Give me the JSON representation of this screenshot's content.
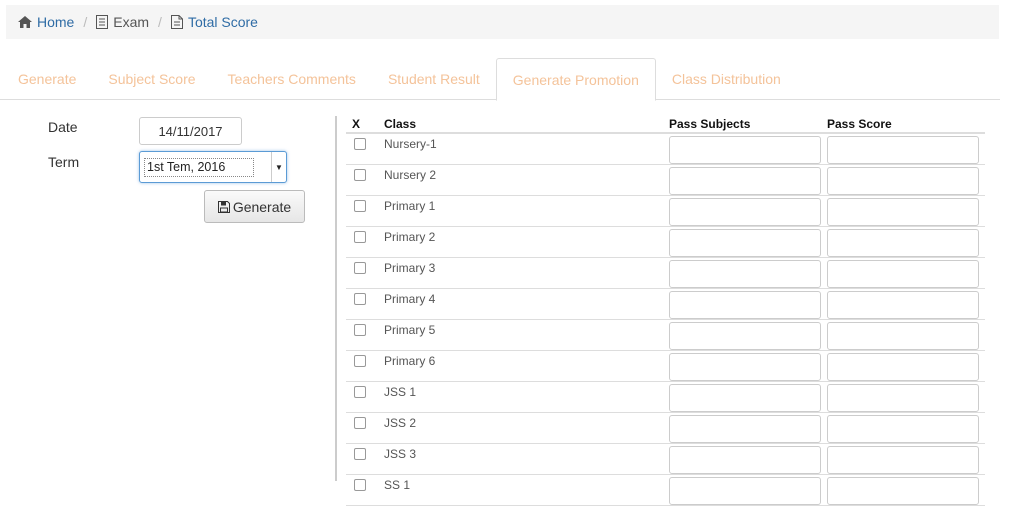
{
  "breadcrumb": {
    "items": [
      {
        "label": "Home",
        "icon": "home-icon"
      },
      {
        "label": "Exam",
        "icon": "document-icon"
      },
      {
        "label": "Total Score",
        "icon": "file-icon"
      }
    ],
    "separator": "/"
  },
  "tabs": [
    {
      "label": "Generate",
      "active": false
    },
    {
      "label": "Subject Score",
      "active": false
    },
    {
      "label": "Teachers Comments",
      "active": false
    },
    {
      "label": "Student Result",
      "active": false
    },
    {
      "label": "Generate Promotion",
      "active": true
    },
    {
      "label": "Class Distribution",
      "active": false
    }
  ],
  "form": {
    "date_label": "Date",
    "date_value": "14/11/2017",
    "term_label": "Term",
    "term_value": "1st Tem, 2016",
    "generate_label": "Generate"
  },
  "table": {
    "headers": {
      "x": "X",
      "class": "Class",
      "pass_subjects": "Pass Subjects",
      "pass_score": "Pass Score"
    },
    "rows": [
      "Nursery-1",
      "Nursery 2",
      "Primary 1",
      "Primary 2",
      "Primary 3",
      "Primary 4",
      "Primary 5",
      "Primary 6",
      "JSS 1",
      "JSS 2",
      "JSS 3",
      "SS 1"
    ]
  },
  "colors": {
    "link": "#2f6ca5",
    "tab_text": "#f4c39a",
    "focus": "#5b9bd5"
  }
}
